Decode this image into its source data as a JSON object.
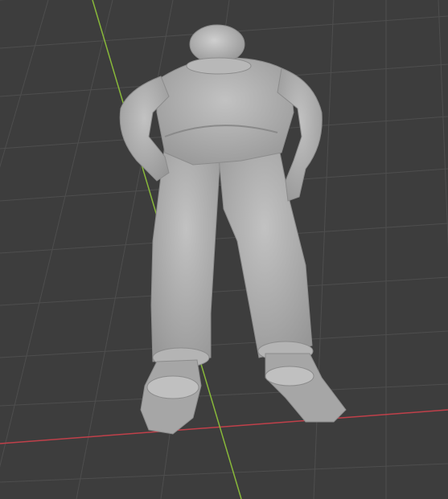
{
  "viewport": {
    "background": "#3d3d3d",
    "grid_color": "#4e4e4e",
    "x_axis_color": "#c0404a",
    "y_axis_color": "#88b83a",
    "model_color": "#a8a8a8",
    "model_shadow": "#8c8c8c",
    "model_highlight": "#c4c4c4"
  }
}
